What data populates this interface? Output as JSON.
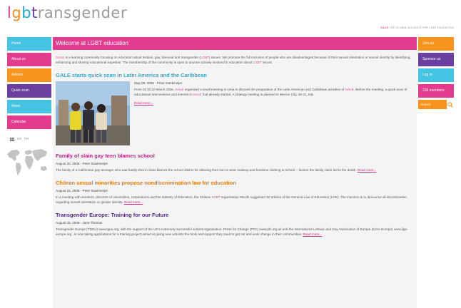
{
  "logo": {
    "p1": "l",
    "p2": "g",
    "p3": "b",
    "p4": "t",
    "rest": "ransgender"
  },
  "tagline": {
    "gale": "GALE",
    "text": " THE GLOBAL ALLIANCE FOR LGBT EDUCATION"
  },
  "left_nav": [
    "Home",
    "About us",
    "Articles",
    "Quick scan",
    "News",
    "Calendar"
  ],
  "languages": [
    "EN",
    "ES",
    "FR"
  ],
  "main": {
    "title": "Welcome at LGBT education",
    "intro": {
      "gale": "GALE",
      "text1": " is a learning community focusing on education about lesbian, gay, bisexual and transgender (",
      "lgbt": "LGBT",
      "text2": ") issues. We promote the full inclusion of people who are disadvantaged because of their sexual orientation or sexual identity by identifying, enhancing and sharing educational expertise. The membership of the community is open to anyone actively involved in education about ",
      "lgbt2": "LGBT",
      "text3": " issues."
    },
    "featured": {
      "title": "GALE starts quick scan in Latin America and the Caribbean",
      "meta": "May 08, 2008 - Peter Dankmeijer",
      "p1_a": "From 20 till 22 March 2008, ",
      "gale1": "GALE",
      "p1_b": " organized a small meeting in Lima to discuss the preparation of the Latin American and Caribbean activities of ",
      "gale2": "GALE",
      "p1_c": ". Before the meeting, a quick scan of educational interventions and interest in ",
      "gale3": "GALE",
      "p1_d": " had already started. A strategy meeting is planned in Mexico City, 29-31 July.",
      "readmore": "Read more..."
    },
    "articles": [
      {
        "title": "Family of slain gay teen blames school",
        "meta": "August 20, 2008 - Peter Dankmeijer",
        "body": "The family of a Californian gay teenager who was fatally shot in class blames the school district for allowing their son to wear makeup and feminine clothing to school -- factors the family claim led to the death.",
        "readmore": "Read more..."
      },
      {
        "title": "Chilean sexual minorities propose nondiscrimination law for education",
        "meta": "August 15, 2008 - Peter Dankmeijer",
        "body_a": "In a meeting with senators, directors of universities, corporations and the Ministry of Education, the Chilean ",
        "lgbt": "LGBT",
        "body_b": " organization Movilh suggested 33 articles of the General Law of Education (LGE). The intention is to denounce all discrimination regarding sexual orientation or gender identity.",
        "readmore": "Read more..."
      },
      {
        "title": "Transgender Europe: Training for our Future",
        "meta": "August 15, 2008 - Jane Thomas",
        "body": "Transgender Europe (TGEU) www.tgeu.org, with the support of the UK's extremely successful activist organisation, Press for Change (PFC) www.pfc.org.uk and the International Lesbian and Gay Association of Europe (ILGA-Europe) www.ilga-europe.org , is now taking applications for a training project aimed at giving new activists the tools and support they need to get out and work change in their communities.",
        "readmore": "Read more..."
      }
    ]
  },
  "right_nav": [
    "Join us",
    "Sponsor us",
    "Log in",
    "236 members"
  ],
  "search": {
    "placeholder": "Search"
  },
  "colors": {
    "pink": "#e33c8f",
    "orange": "#f7941d",
    "cyan": "#45c3e3",
    "purple": "#6a3fa0",
    "title_teal": "#3aa9cc",
    "title_pink": "#c8258a",
    "title_orange": "#e87b12",
    "title_purple": "#4b2a86"
  }
}
